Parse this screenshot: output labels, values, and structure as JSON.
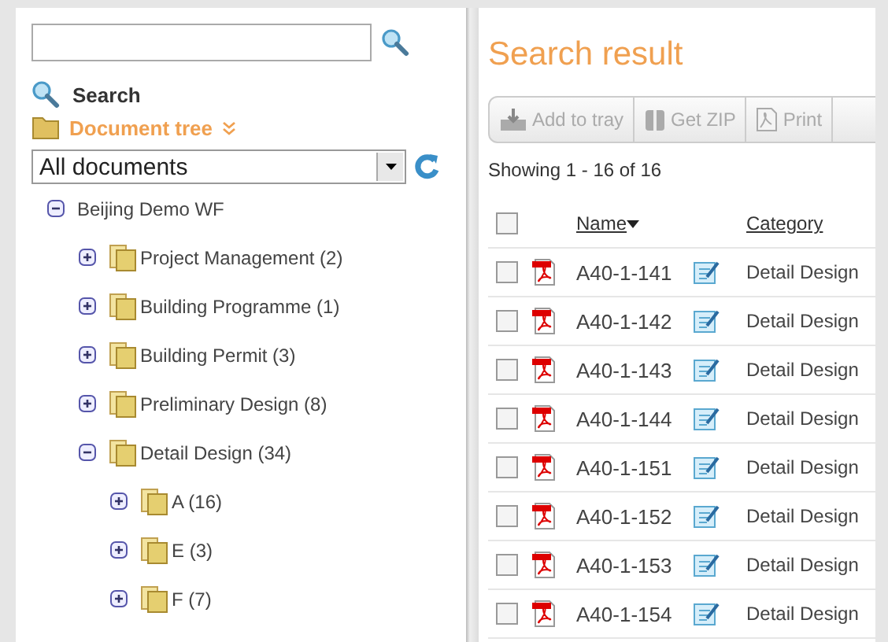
{
  "search_link": "Search",
  "tree_heading": "Document tree",
  "scope_select": {
    "value": "All documents"
  },
  "tree": [
    {
      "label": "Beijing Demo WF",
      "expanded": true,
      "children": [
        {
          "label": "Project Management (2)",
          "expanded": false
        },
        {
          "label": "Building Programme (1)",
          "expanded": false
        },
        {
          "label": "Building Permit (3)",
          "expanded": false
        },
        {
          "label": "Preliminary Design (8)",
          "expanded": false
        },
        {
          "label": "Detail Design (34)",
          "expanded": true,
          "children": [
            {
              "label": "A (16)",
              "expanded": false
            },
            {
              "label": "E (3)",
              "expanded": false
            },
            {
              "label": "F (7)",
              "expanded": false
            }
          ]
        }
      ]
    }
  ],
  "result_title": "Search result",
  "toolbar": [
    {
      "label": "Add to tray",
      "kind": "tray"
    },
    {
      "label": "Get ZIP",
      "kind": "zip"
    },
    {
      "label": "Print",
      "kind": "print"
    }
  ],
  "paging": "Showing 1 - 16 of 16",
  "table": {
    "select_all_checked": false,
    "columns": [
      {
        "label": "Name",
        "sorted": true
      },
      {
        "label": "Category",
        "sorted": false
      }
    ],
    "rows": [
      {
        "name": "A40-1-141",
        "category": "Detail Design",
        "checked": false
      },
      {
        "name": "A40-1-142",
        "category": "Detail Design",
        "checked": false
      },
      {
        "name": "A40-1-143",
        "category": "Detail Design",
        "checked": false
      },
      {
        "name": "A40-1-144",
        "category": "Detail Design",
        "checked": false
      },
      {
        "name": "A40-1-151",
        "category": "Detail Design",
        "checked": false
      },
      {
        "name": "A40-1-152",
        "category": "Detail Design",
        "checked": false
      },
      {
        "name": "A40-1-153",
        "category": "Detail Design",
        "checked": false
      },
      {
        "name": "A40-1-154",
        "category": "Detail Design",
        "checked": false
      }
    ]
  }
}
